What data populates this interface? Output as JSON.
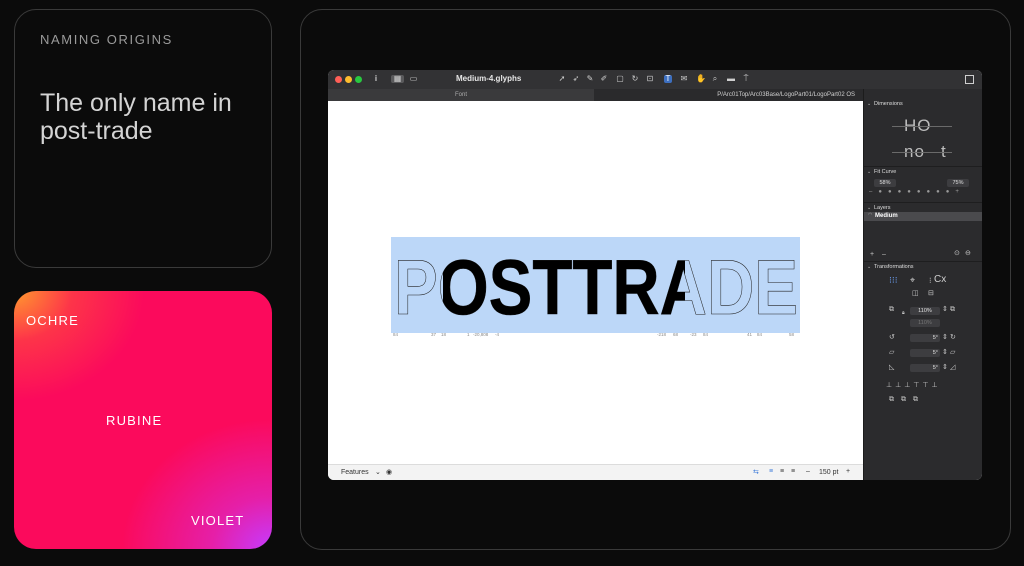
{
  "left_card": {
    "eyebrow": "NAMING ORIGINS",
    "headline": "The only name in post-trade"
  },
  "gradient_card": {
    "labels": [
      "OCHRE",
      "RUBINE",
      "VIOLET"
    ],
    "colors": {
      "ochre": "#ff9a2e",
      "rubine": "#fb0a5c",
      "violet": "#c63bff"
    }
  },
  "app": {
    "title": "Medium-4.glyphs",
    "tab_font": "Font",
    "tab_path": "P/Arc01Top/Arc03Base/LogoPart01/LogoPart02 OS",
    "glyph_text": "POSTTRADE",
    "metrics": [
      "84",
      "37",
      "18",
      "1",
      "-20,808",
      "-4",
      "-218",
      "68",
      "-23",
      "84",
      "41",
      "84",
      "58"
    ],
    "bottom": {
      "features_label": "Features",
      "zoom": "150 pt",
      "minus": "–",
      "plus": "+"
    },
    "inspector": {
      "dimensions_title": "Dimensions",
      "dimension_glyphs": [
        "HO",
        "no",
        "t"
      ],
      "fit_curve_title": "Fit Curve",
      "fit_curve_low": "58%",
      "fit_curve_high": "75%",
      "layers_title": "Layers",
      "active_layer": "Medium",
      "transformations_title": "Transformations",
      "scale_value": "110%",
      "scale_value_2": "110%",
      "rotate_value": "5°",
      "skew_value": "5°",
      "slant_value": "5°",
      "cx_label": "Cx"
    }
  }
}
